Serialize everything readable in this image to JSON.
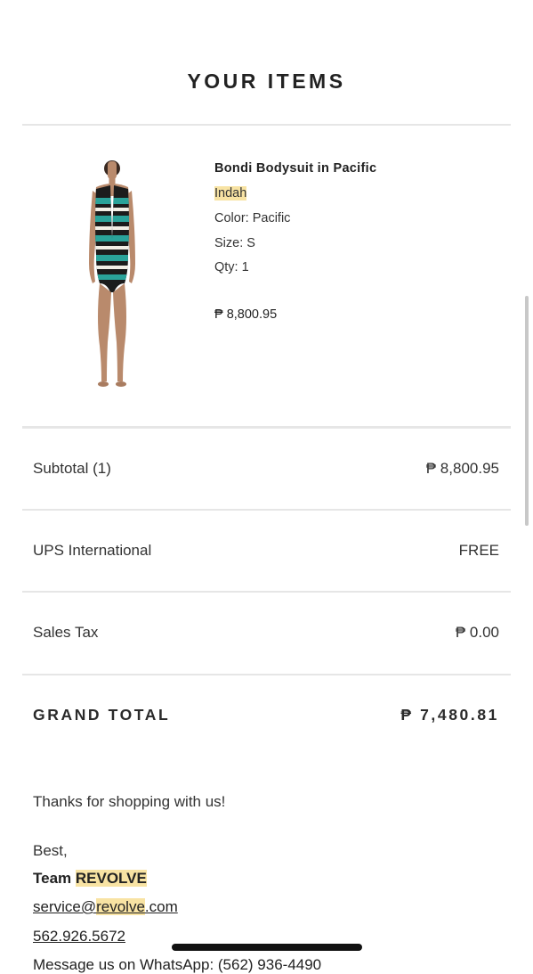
{
  "section_title": "YOUR ITEMS",
  "item": {
    "name": "Bondi Bodysuit in Pacific",
    "brand": "Indah",
    "color": "Color: Pacific",
    "size": "Size: S",
    "qty": "Qty: 1",
    "price": "₱ 8,800.95",
    "image_icon": "product-photo-swimsuit"
  },
  "summary": {
    "subtotal_label": "Subtotal (1)",
    "subtotal_value": "₱ 8,800.95",
    "shipping_label": "UPS International",
    "shipping_value": "FREE",
    "tax_label": "Sales Tax",
    "tax_value": "₱ 0.00",
    "grand_total_label": "GRAND TOTAL",
    "grand_total_value": "₱ 7,480.81"
  },
  "closing": {
    "thanks": "Thanks for shopping with us!",
    "best": "Best,",
    "team_prefix": "Team ",
    "team_name": "REVOLVE",
    "email_prefix": "service@",
    "email_domain": "revolve",
    "email_suffix": ".com",
    "phone": "562.926.5672",
    "cut_line": "Message us on WhatsApp: (562) 936-4490"
  },
  "colors": {
    "highlight": "#f8e3a3",
    "divider": "#e6e6e6",
    "text": "#2b2b2b"
  }
}
